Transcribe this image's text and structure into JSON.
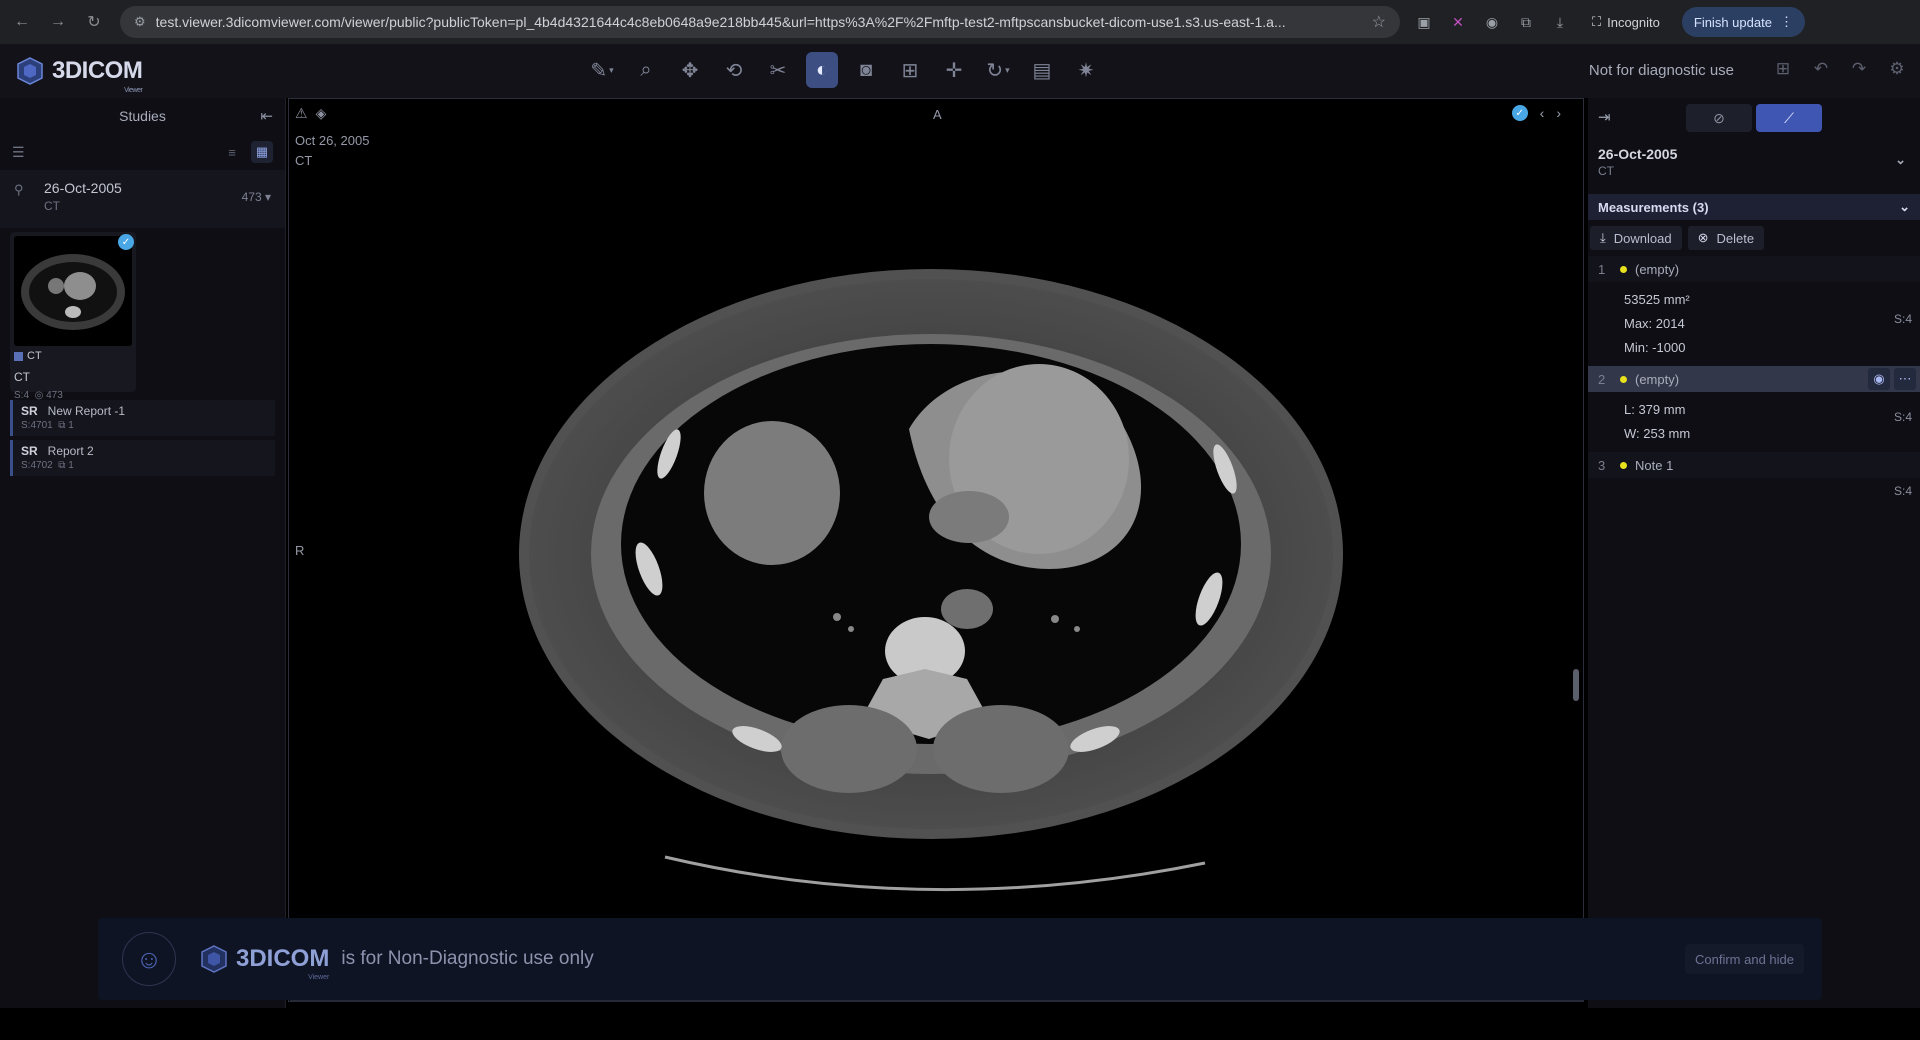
{
  "browser": {
    "url": "test.viewer.3dicomviewer.com/viewer/public?publicToken=pl_4b4d4321644c4c8eb0648a9e218bb445&url=https%3A%2F%2Fmftp-test2-mftpscansbucket-dicom-use1.s3.us-east-1.a...",
    "incognito_label": "Incognito",
    "finish_update_label": "Finish update"
  },
  "app": {
    "logo_text": "3DICOM",
    "logo_sub": "Viewer",
    "not_for_diagnostic": "Not for diagnostic use",
    "active_tool": "contour-icon",
    "accent": "#3f56b3"
  },
  "left_panel": {
    "title": "Studies",
    "study": {
      "date": "26-Oct-2005",
      "modality": "CT",
      "count": "473"
    },
    "series_thumb": {
      "modality_tag": "CT",
      "label": "CT",
      "meta_s": "S:4",
      "meta_count": "473"
    },
    "reports": [
      {
        "type": "SR",
        "name": "New Report -1",
        "series": "S:4701",
        "count": "1"
      },
      {
        "type": "SR",
        "name": "Report 2",
        "series": "S:4702",
        "count": "1"
      }
    ]
  },
  "viewport": {
    "date": "Oct 26, 2005",
    "modality": "CT",
    "orient_top": "A",
    "orient_left": "R"
  },
  "right_panel": {
    "study_date": "26-Oct-2005",
    "study_modality": "CT",
    "measurements_title": "Measurements (3)",
    "download_label": "Download",
    "delete_label": "Delete",
    "measurements": [
      {
        "num": "1",
        "label": "(empty)",
        "lines": [
          "53525 mm²",
          "Max: 2014",
          "Min: -1000"
        ],
        "series": "S:4"
      },
      {
        "num": "2",
        "label": "(empty)",
        "lines": [
          "L: 379 mm",
          "W: 253 mm"
        ],
        "series": "S:4"
      },
      {
        "num": "3",
        "label": "Note 1",
        "lines": [],
        "series": "S:4"
      }
    ]
  },
  "banner": {
    "logo_text": "3DICOM",
    "logo_sub": "Viewer",
    "message": "is for Non-Diagnostic use only",
    "confirm_label": "Confirm and hide"
  }
}
